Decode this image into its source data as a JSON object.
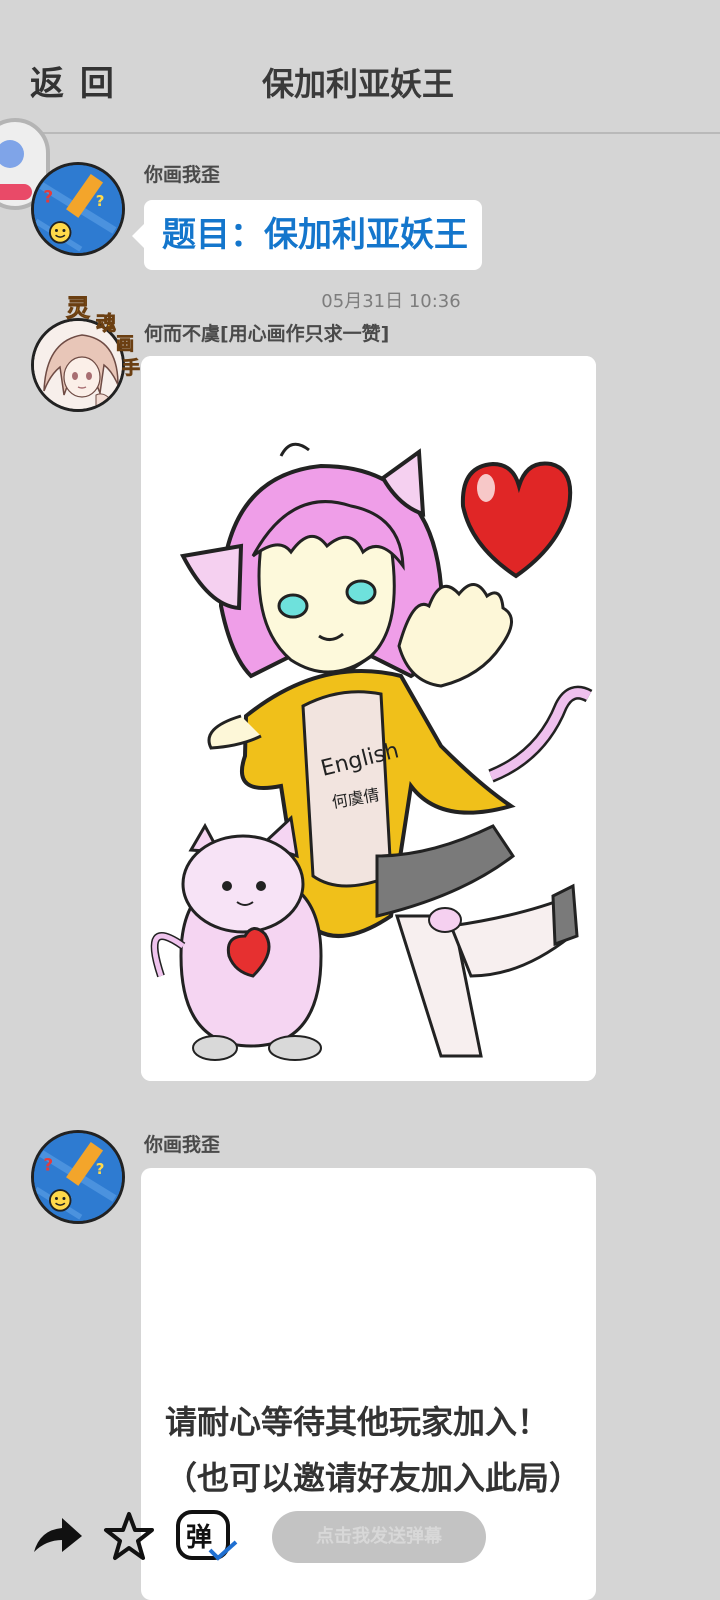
{
  "header": {
    "back_label": "返 回",
    "title": "保加利亚妖王"
  },
  "messages": [
    {
      "sender": "你画我歪",
      "text": "题目：保加利亚妖王"
    },
    {
      "timestamp": "05月31日  10:36",
      "sender": "何而不虞[用心画作只求一赞]",
      "badge_text": "灵魂画手",
      "drawing_text": [
        "English",
        "何虞倩"
      ]
    },
    {
      "sender": "你画我歪",
      "text_line1": "请耐心等待其他玩家加入！",
      "text_line2": "（也可以邀请好友加入此局）"
    }
  ],
  "toolbar": {
    "share_icon": "share-arrow-icon",
    "favorite_icon": "star-icon",
    "danmaku_icon": "danmaku-toggle-icon",
    "danmaku_glyph": "弹",
    "danmaku_placeholder": "点击我发送弹幕"
  },
  "colors": {
    "background": "#d5d5d5",
    "topic_text": "#1476cc",
    "bubble": "#ffffff"
  }
}
